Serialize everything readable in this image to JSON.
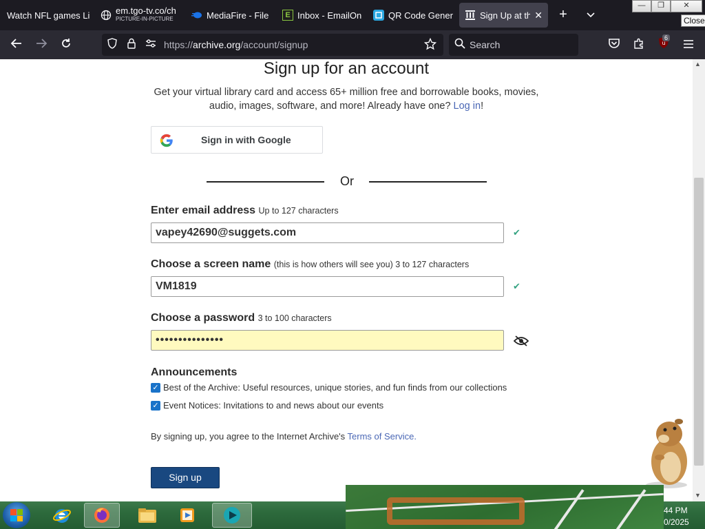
{
  "tabs": [
    {
      "title": "Watch NFL games Li",
      "subtitle": "",
      "icon": "none"
    },
    {
      "title": "em.tgo-tv.co/ch",
      "subtitle": "PICTURE-IN-PICTURE",
      "icon": "globe-icon"
    },
    {
      "title": "MediaFire - File s",
      "subtitle": "",
      "icon": "mediafire-icon"
    },
    {
      "title": "Inbox - EmailOn",
      "subtitle": "",
      "icon": "emailondeck-icon"
    },
    {
      "title": "QR Code Genera",
      "subtitle": "",
      "icon": "qr-icon"
    },
    {
      "title": "Sign Up at the",
      "subtitle": "",
      "icon": "archive-icon"
    }
  ],
  "window": {
    "minimize": "—",
    "maximize": "❐",
    "close": "✕",
    "tooltip": "Close"
  },
  "urlbar": {
    "pre": "https://",
    "domain": "archive.org",
    "post": "/account/signup"
  },
  "search": {
    "placeholder": "Search"
  },
  "extensions_badge": "6",
  "page": {
    "title": "Sign up for an account",
    "intro_text": "Get your virtual library card and access 65+ million free and borrowable books, movies, audio, images, software, and more! Already have one? ",
    "login_link": "Log in",
    "intro_end": "!",
    "google_button": "Sign in with Google",
    "or": "Or",
    "email": {
      "label": "Enter email address",
      "hint": "Up to 127 characters",
      "value": "vapey42690@suggets.com"
    },
    "screen_name": {
      "label": "Choose a screen name",
      "hint": "(this is how others will see you) 3 to 127 characters",
      "value": "VM1819"
    },
    "password": {
      "label": "Choose a password",
      "hint": "3 to 100 characters",
      "value": "•••••••••••••••"
    },
    "announcements": {
      "title": "Announcements",
      "items": [
        {
          "label": "Best of the Archive: Useful resources, unique stories, and fun finds from our collections",
          "checked": true
        },
        {
          "label": "Event Notices: Invitations to and news about our events",
          "checked": true
        }
      ]
    },
    "terms_prefix": "By signing up, you agree to the Internet Archive's ",
    "terms_link": "Terms of Service",
    "terms_suffix": ".",
    "signup_button": "Sign up",
    "checkmark": "✔"
  },
  "taskbar": {
    "clock_time": "44 PM",
    "clock_date": "0/2025"
  },
  "colors": {
    "link": "#4a67b5",
    "signup": "#194880",
    "check": "#35a381",
    "password_bg": "#fffabf",
    "checkbox": "#1a73c9"
  }
}
